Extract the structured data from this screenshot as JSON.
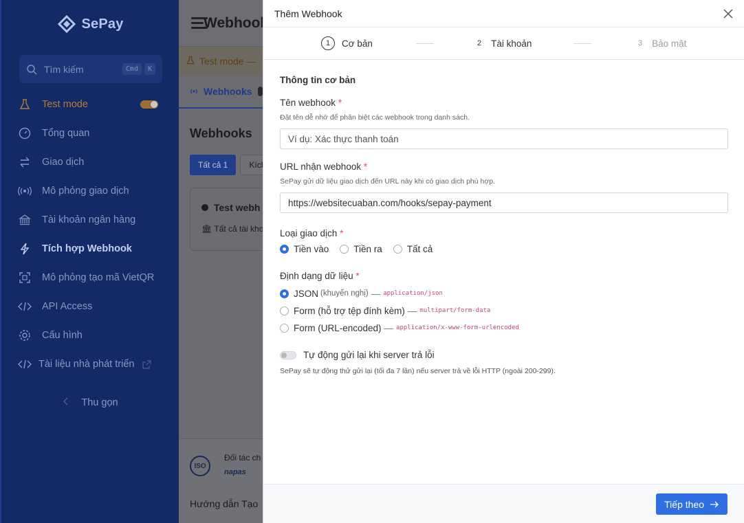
{
  "sidebar": {
    "brand": "SePay",
    "search": {
      "placeholder": "Tìm kiếm",
      "kbd1": "Cmd",
      "kbd2": "K"
    },
    "items": [
      {
        "label": "Test mode",
        "icon": "flask-icon"
      },
      {
        "label": "Tổng quan",
        "icon": "dashboard-icon"
      },
      {
        "label": "Giao dịch",
        "icon": "transfer-icon"
      },
      {
        "label": "Mô phỏng giao dịch",
        "icon": "broadcast-icon"
      },
      {
        "label": "Tài khoản ngân hàng",
        "icon": "bank-icon"
      },
      {
        "label": "Tích hợp Webhook",
        "icon": "bolt-icon"
      },
      {
        "label": "Mô phỏng tạo mã VietQR",
        "icon": "qr-icon"
      },
      {
        "label": "API Access",
        "icon": "code-icon"
      },
      {
        "label": "Cấu hình",
        "icon": "gear-icon"
      },
      {
        "label": "Tài liệu nhà phát triển",
        "icon": "code-icon"
      }
    ],
    "collapse_label": "Thu gọn"
  },
  "background": {
    "title": "Webhooks",
    "test_banner": "Test mode —",
    "tab": "Webhooks",
    "heading": "Webhooks",
    "filter_all": "Tất cả 1",
    "filter_2": "Kích",
    "card_title": "Test webh",
    "card_sub": "Tất cả tài kho",
    "partner": "Đối tác ch",
    "napas": "napas",
    "iso": "ISO",
    "links": "Hướng dẫn  Tạo"
  },
  "modal": {
    "title": "Thêm Webhook",
    "steps": [
      {
        "num": "1",
        "label": "Cơ bản"
      },
      {
        "num": "2",
        "label": "Tài khoản"
      },
      {
        "num": "3",
        "label": "Bảo mật"
      }
    ],
    "section_title": "Thông tin cơ bản",
    "name": {
      "label": "Tên webhook",
      "help": "Đặt tên dễ nhớ để phân biệt các webhook trong danh sách.",
      "placeholder": "Ví dụ: Xác thực thanh toán"
    },
    "url": {
      "label": "URL nhận webhook",
      "help": "SePay gửi dữ liệu giao dịch đến URL này khi có giao dịch phù hợp.",
      "value": "https://websitecuaban.com/hooks/sepay-payment"
    },
    "tx_type": {
      "label": "Loại giao dịch",
      "options": [
        "Tiền vào",
        "Tiền ra",
        "Tất cả"
      ],
      "selected": "Tiền vào"
    },
    "format": {
      "label": "Định dạng dữ liệu",
      "options": [
        {
          "name": "JSON",
          "hint": "(khuyến nghị)",
          "mime": "application/json"
        },
        {
          "name": "Form (hỗ trợ tệp đính kèm)",
          "hint": "",
          "mime": "multipart/form-data"
        },
        {
          "name": "Form (URL-encoded)",
          "hint": "",
          "mime": "application/x-www-form-urlencoded"
        }
      ],
      "selected": "JSON"
    },
    "retry": {
      "label": "Tự động gửi lại khi server trả lỗi",
      "help": "SePay sẽ tự động thử gửi lại (tối đa 7 lần) nếu server trả về lỗi HTTP (ngoài 200-299).",
      "enabled": false
    },
    "next_button": "Tiếp theo"
  },
  "colors": {
    "primary": "#2f6fe2",
    "required": "#e04b5a",
    "mime": "#d0407f",
    "sidebar": "#142a66"
  }
}
